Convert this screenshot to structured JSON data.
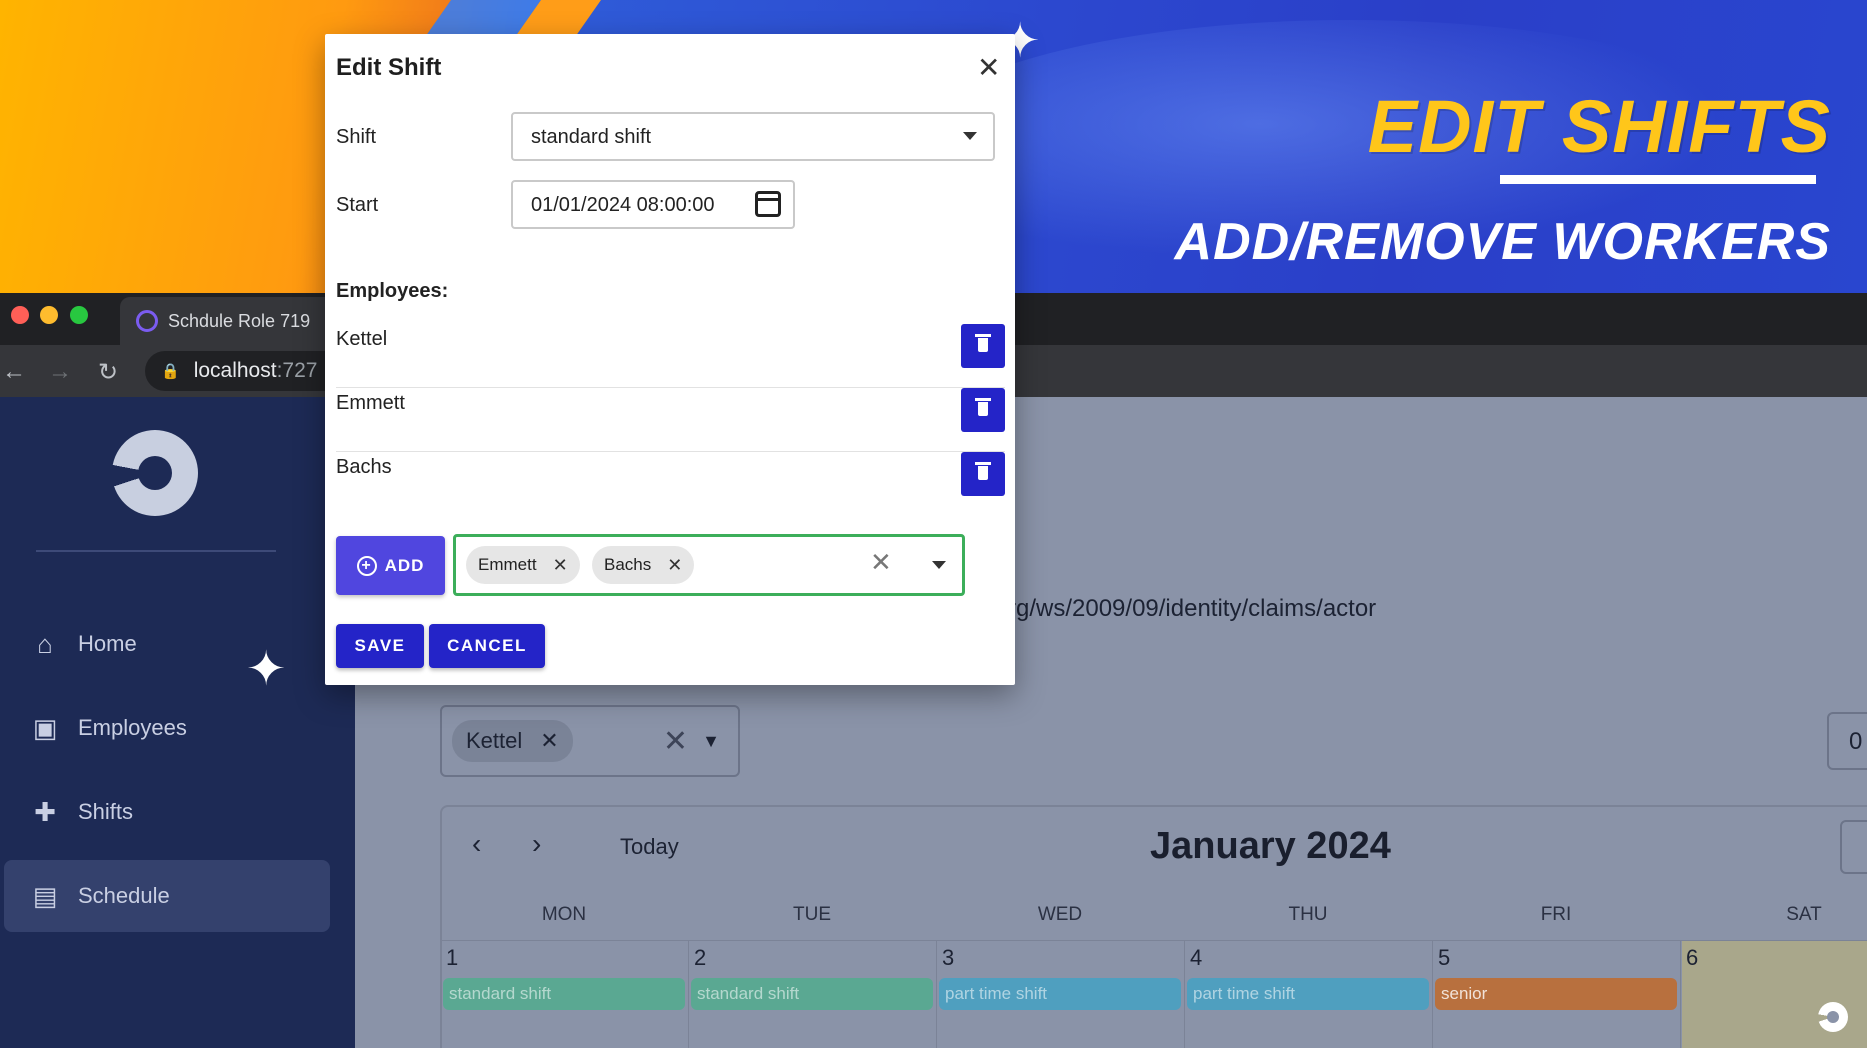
{
  "banner": {
    "title": "EDIT SHIFTS",
    "subtitle": "ADD/REMOVE WORKERS"
  },
  "browser": {
    "tab_title": "Schdule Role 719",
    "url_host": "localhost",
    "url_port": ":727"
  },
  "sidebar": {
    "items": [
      {
        "label": "Home",
        "icon": "home-icon"
      },
      {
        "label": "Employees",
        "icon": "person-badge-icon"
      },
      {
        "label": "Shifts",
        "icon": "puzzle-icon"
      },
      {
        "label": "Schedule",
        "icon": "clipboard-icon",
        "active": true
      }
    ]
  },
  "main": {
    "claim_text": "rg/ws/2009/09/identity/claims/actor",
    "employee_filter_chip": "Kettel",
    "right_box_text": "0"
  },
  "calendar": {
    "today_label": "Today",
    "title": "January 2024",
    "weekdays": [
      "MON",
      "TUE",
      "WED",
      "THU",
      "FRI",
      "SAT"
    ],
    "days": [
      "1",
      "2",
      "3",
      "4",
      "5",
      "6"
    ],
    "events": [
      {
        "label": "standard shift",
        "color": "#5aa892"
      },
      {
        "label": "standard shift",
        "color": "#5aa892"
      },
      {
        "label": "part time shift",
        "color": "#4f9fbf"
      },
      {
        "label": "part time shift",
        "color": "#4f9fbf"
      },
      {
        "label": "senior",
        "color": "#b8703e"
      }
    ]
  },
  "modal": {
    "title": "Edit Shift",
    "shift_label": "Shift",
    "shift_value": "standard shift",
    "start_label": "Start",
    "start_value": "01/01/2024 08:00:00",
    "employees_header": "Employees:",
    "employees": [
      "Kettel",
      "Emmett",
      "Bachs"
    ],
    "add_label": "ADD",
    "selected_chips": [
      "Emmett",
      "Bachs"
    ],
    "save_label": "SAVE",
    "cancel_label": "CANCEL"
  },
  "colors": {
    "primary_button": "#2424c8",
    "add_button": "#5046df",
    "multi_select_border": "#3cae5a",
    "banner_title": "#ffc61a"
  }
}
